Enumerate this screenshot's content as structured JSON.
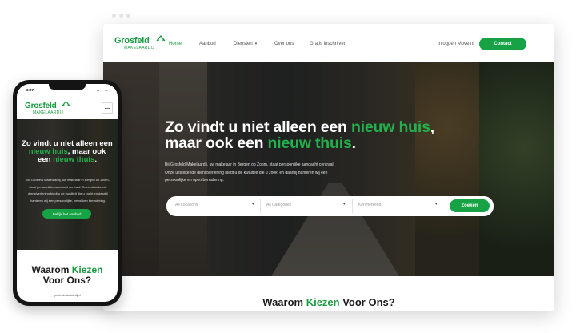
{
  "brand": {
    "name": "Grosfeld",
    "sub": "MAKELAARDIJ",
    "green": "#1a9b41",
    "button_green": "#17a345",
    "logo_icon": "house-roof-icon"
  },
  "desktop": {
    "nav": {
      "links": [
        "Home",
        "Aanbod",
        "Diensten",
        "Over ons",
        "Gratis inschrijven"
      ],
      "dropdown_caret": "▾",
      "login": "Inloggen Move.nl",
      "contact": "Contact"
    },
    "hero": {
      "title_1": "Zo vindt u niet alleen een ",
      "title_1_green": "nieuw huis",
      "title_1_end": ",",
      "title_2": "maar ook een ",
      "title_2_green": "nieuw thuis",
      "title_2_end": ".",
      "paragraph": "Bij Grosfeld Makelaardij, uw makelaar in Bergen op Zoom, staat persoonlijke aandacht centraal. Onze uitstekende dienstverlening biedt u de kwaliteit die u zoekt en daarbij hanteren wij een persoonlijke en open benadering."
    },
    "search": {
      "locations": "All Locations",
      "categories": "All Categories",
      "keyword": "Kenmerkend",
      "button": "Zoeken"
    },
    "section_title_1": "Waarom ",
    "section_title_green": "Kiezen",
    "section_title_2": " Voor Ons?"
  },
  "phone": {
    "time": "3:07",
    "status": "▪▪ ◔ ▭",
    "hero": {
      "title_1": "Zo vindt u niet alleen een ",
      "title_green_1": "nieuw huis",
      "title_2": ", maar ook een ",
      "title_green_2": "nieuw thuis",
      "title_end": ".",
      "paragraph": "Bij Grosfeld Makelaardij, uw makelaar in Bergen op Zoom, staat persoonlijke aandacht centraal. Onze uitstekende dienstverlening biedt u de kwaliteit die u zoekt en daarbij hanteren wij een persoonlijke, betrokken benadering.",
      "button": "Bekijk het aanbod"
    },
    "section_title_1": "Waarom ",
    "section_title_green": "Kiezen",
    "section_title_2": "Voor Ons?",
    "url": "grosfeldmakelaardij.nl"
  }
}
